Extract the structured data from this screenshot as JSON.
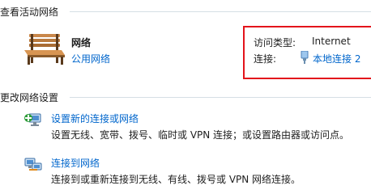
{
  "active_networks": {
    "header": "查看活动网络",
    "network": {
      "name": "网络",
      "type_link": "公用网络",
      "icon": "park-bench-icon"
    },
    "details": {
      "access_type_label": "访问类型:",
      "access_type_value": "Internet",
      "connection_label": "连接:",
      "connection_value": "本地连接 2",
      "connection_icon": "ethernet-icon"
    },
    "highlight_color": "#e3141b"
  },
  "change_settings": {
    "header": "更改网络设置",
    "items": [
      {
        "title": "设置新的连接或网络",
        "description": "设置无线、宽带、拨号、临时或 VPN 连接；或设置路由器或访问点。",
        "icon": "new-connection-icon"
      },
      {
        "title": "连接到网络",
        "description": "连接到或重新连接到无线、有线、拨号或 VPN 网络连接。",
        "icon": "connect-network-icon"
      }
    ]
  },
  "colors": {
    "link": "#0066cc",
    "text": "#1e1e1e",
    "rule": "#d5dfe5"
  }
}
